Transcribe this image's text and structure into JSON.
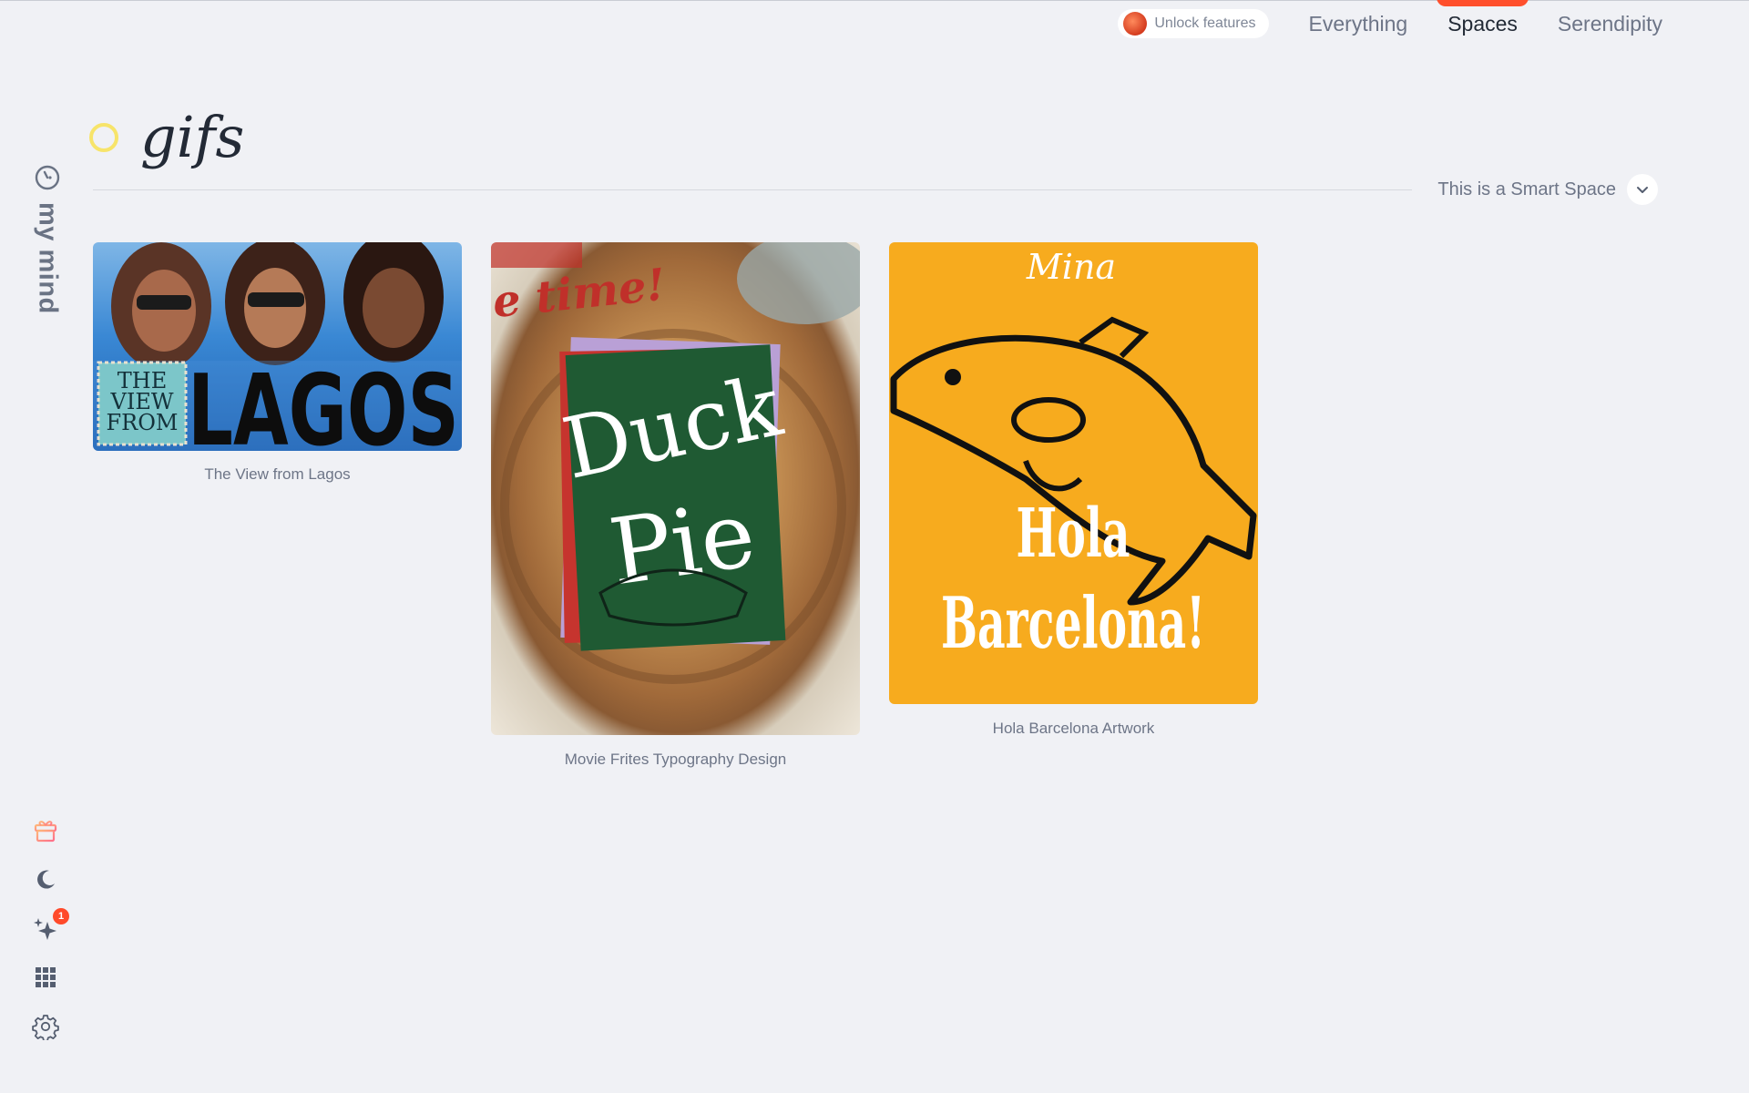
{
  "topnav": {
    "unlock_label": "Unlock features",
    "tabs": [
      {
        "label": "Everything",
        "active": false
      },
      {
        "label": "Spaces",
        "active": true
      },
      {
        "label": "Serendipity",
        "active": false
      }
    ],
    "accent_color": "#ff4f2c"
  },
  "sidebar": {
    "brand": "my mind",
    "icons": [
      "gift-icon",
      "moon-icon",
      "sparkle-icon",
      "grid-icon",
      "gear-icon"
    ],
    "notification_count": "1"
  },
  "space": {
    "title": "gifs",
    "smart_label": "This is a Smart Space"
  },
  "cards": [
    {
      "caption": "The View from Lagos",
      "art_lines": [
        "THE",
        "VIEW",
        "FROM"
      ],
      "art_title": "LAGOS"
    },
    {
      "caption": "Movie Frites Typography Design",
      "art_top": "e time!",
      "art_title_1": "Duck",
      "art_title_2": "Pie"
    },
    {
      "caption": "Hola Barcelona Artwork",
      "art_script": "Mina",
      "art_title_1": "Hola",
      "art_title_2": "Barcelona!"
    }
  ]
}
